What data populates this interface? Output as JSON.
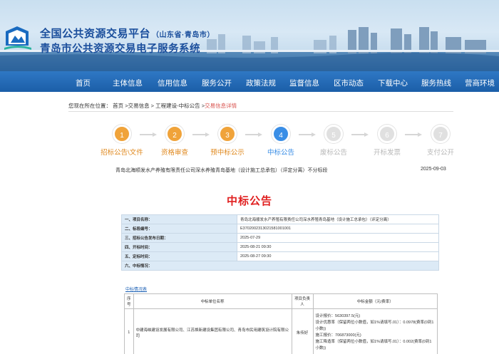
{
  "header": {
    "title": "全国公共资源交易平台",
    "region": "（山东省·青岛市）",
    "subtitle": "青岛市公共资源交易电子服务系统"
  },
  "nav": {
    "items": [
      "首页",
      "主体信息",
      "信用信息",
      "服务公开",
      "政策法规",
      "监督信息",
      "区市动态",
      "下载中心",
      "服务热线",
      "营商环境"
    ]
  },
  "breadcrumb": {
    "prefix": "您现在所在位置：",
    "parts": [
      "首页",
      ">交易信息",
      "> 工程建设-中标公告",
      ">"
    ],
    "current": "交易信息详情"
  },
  "steps": [
    {
      "num": "1",
      "label": "招标公告\\文件",
      "state": "done"
    },
    {
      "num": "2",
      "label": "资格审查",
      "state": "done"
    },
    {
      "num": "3",
      "label": "预中标公示",
      "state": "done"
    },
    {
      "num": "4",
      "label": "中标公告",
      "state": "current"
    },
    {
      "num": "5",
      "label": "废标公告",
      "state": "todo"
    },
    {
      "num": "6",
      "label": "开标发票",
      "state": "todo"
    },
    {
      "num": "7",
      "label": "支付公开",
      "state": "todo"
    }
  ],
  "info": {
    "project_line": "青岛北海顺发水产养殖有限责任公司深水养殖青岛基地（设计施工总承包）（评定分离）不分标段",
    "date": "2025-09-03"
  },
  "announcement": {
    "title": "中标公告",
    "rows": [
      {
        "key": "一、项目名称：",
        "value": "青岛北海顺发水产养殖有限责任公司深水养殖青岛基地（设计施工总承包）（评定分离）"
      },
      {
        "key": "二、标段编号：",
        "value": "E3702002313021581001001"
      },
      {
        "key": "三、招标公告发布日期：",
        "value": "2025-07-29"
      },
      {
        "key": "四、开标时间：",
        "value": "2025-08-21 09:30"
      },
      {
        "key": "五、定标时间：",
        "value": "2025-08-27 09:30"
      },
      {
        "key": "六、中标情况：",
        "value": ""
      }
    ],
    "winner_link": "中标情况表",
    "winner_table": {
      "headers": [
        "序号",
        "中标单位名称",
        "项目负责人",
        "中标金额（元/费率）"
      ],
      "rows": [
        {
          "idx": "1",
          "name": "中建海峡建设发展有限公司、江苏焕新建设集团有限公司、青岛市民用建筑设计院有限公司",
          "person": "朱传好",
          "amount": [
            "设计报价：5630397.5(元)",
            "设计优惠率（保留两位小数值，如1%请填写.01）：0.0978(费率(0到1小数))",
            "施工报价：706873000(元)",
            "施工降造率（保留两位小数值，如1%请填写.01）：0.002(费率(0到1小数))"
          ]
        }
      ]
    }
  },
  "colors": {
    "nav_bg": "#1b5ea8",
    "title_blue": "#1a4e9c",
    "step_done": "#f0a33a",
    "step_current": "#3a8ee6",
    "step_todo": "#e0e0e0",
    "announce_red": "#e02020",
    "table_key_bg": "#dceaf6"
  }
}
